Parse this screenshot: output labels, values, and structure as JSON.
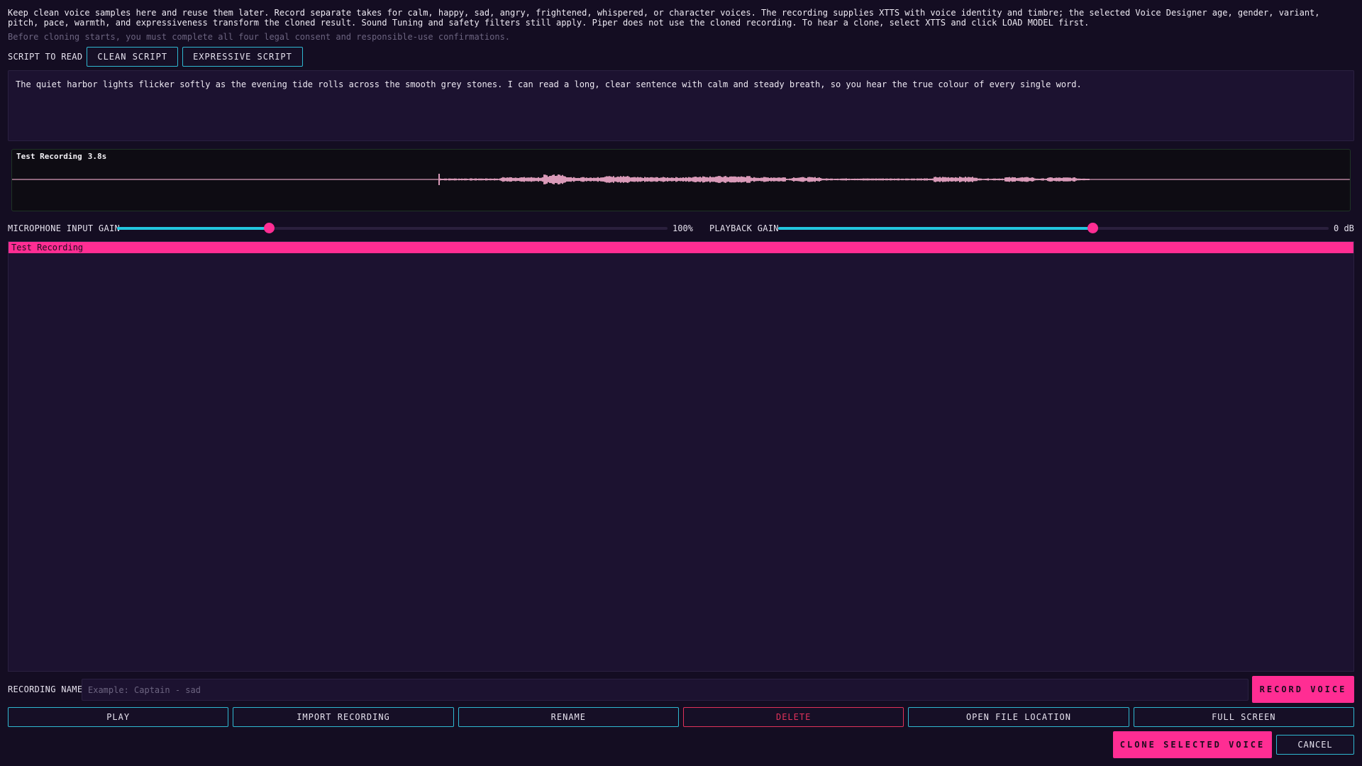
{
  "intro": {
    "description": "Keep clean voice samples here and reuse them later. Record separate takes for calm, happy, sad, angry, frightened, whispered, or character voices. The recording supplies XTTS with voice identity and timbre; the selected Voice Designer age, gender, variant, pitch, pace, warmth, and expressiveness transform the cloned result. Sound Tuning and safety filters still apply. Piper does not use the cloned recording. To hear a clone, select XTTS and click LOAD MODEL first.",
    "consent_warning": "Before cloning starts, you must complete all four legal consent and responsible-use confirmations."
  },
  "script": {
    "label": "SCRIPT TO READ",
    "clean_button": "CLEAN SCRIPT",
    "expressive_button": "EXPRESSIVE SCRIPT",
    "text": "The quiet harbor lights flicker softly as the evening tide rolls across the smooth grey stones. I can read a long, clear sentence with calm and steady breath, so you hear the true colour of every single word."
  },
  "waveform": {
    "title": "Test Recording",
    "duration": "3.8s"
  },
  "gain": {
    "mic_label": "MICROPHONE INPUT GAIN",
    "mic_value_text": "100%",
    "mic_level": 0.276,
    "playback_label": "PLAYBACK GAIN",
    "playback_value_text": "0 dB",
    "playback_level": 0.571
  },
  "recordings": {
    "items": [
      "Test Recording"
    ],
    "selected_index": 0
  },
  "name_field": {
    "label": "RECORDING NAME",
    "value": "",
    "placeholder": "Example: Captain - sad"
  },
  "buttons": {
    "record": "RECORD VOICE",
    "play": "PLAY",
    "import": "IMPORT RECORDING",
    "rename": "RENAME",
    "delete": "DELETE",
    "open_location": "OPEN FILE LOCATION",
    "full_screen": "FULL SCREEN",
    "clone": "CLONE SELECTED VOICE",
    "cancel": "CANCEL"
  },
  "colors": {
    "accent_pink": "#ff2d93",
    "accent_cyan": "#23c6e0",
    "danger": "#e0325a",
    "background": "#140d22",
    "waveform": "#d99ab8"
  }
}
